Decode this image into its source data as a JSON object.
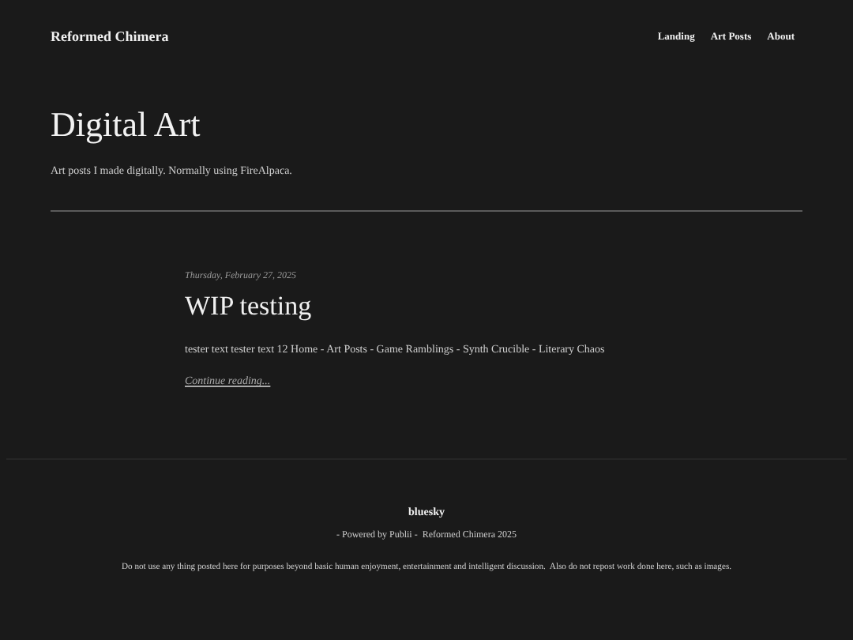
{
  "site_title": "Reformed Chimera",
  "nav": [
    {
      "label": "Landing"
    },
    {
      "label": "Art Posts"
    },
    {
      "label": "About"
    }
  ],
  "page": {
    "title": "Digital Art",
    "description": "Art posts I made digitally. Normally using FireAlpaca."
  },
  "posts": [
    {
      "date": "Thursday, February 27, 2025",
      "title": "WIP testing",
      "excerpt": "tester text tester text 12 Home - Art Posts - Game Ramblings - Synth Crucible - Literary Chaos",
      "more": "Continue reading..."
    }
  ],
  "footer": {
    "social": "bluesky",
    "credit": "- Powered by Publii -  Reformed Chimera 2025",
    "notice": "Do not use any thing posted here for purposes beyond basic human enjoyment, entertainment and intelligent discussion.  Also do not repost work done here, such as images."
  }
}
